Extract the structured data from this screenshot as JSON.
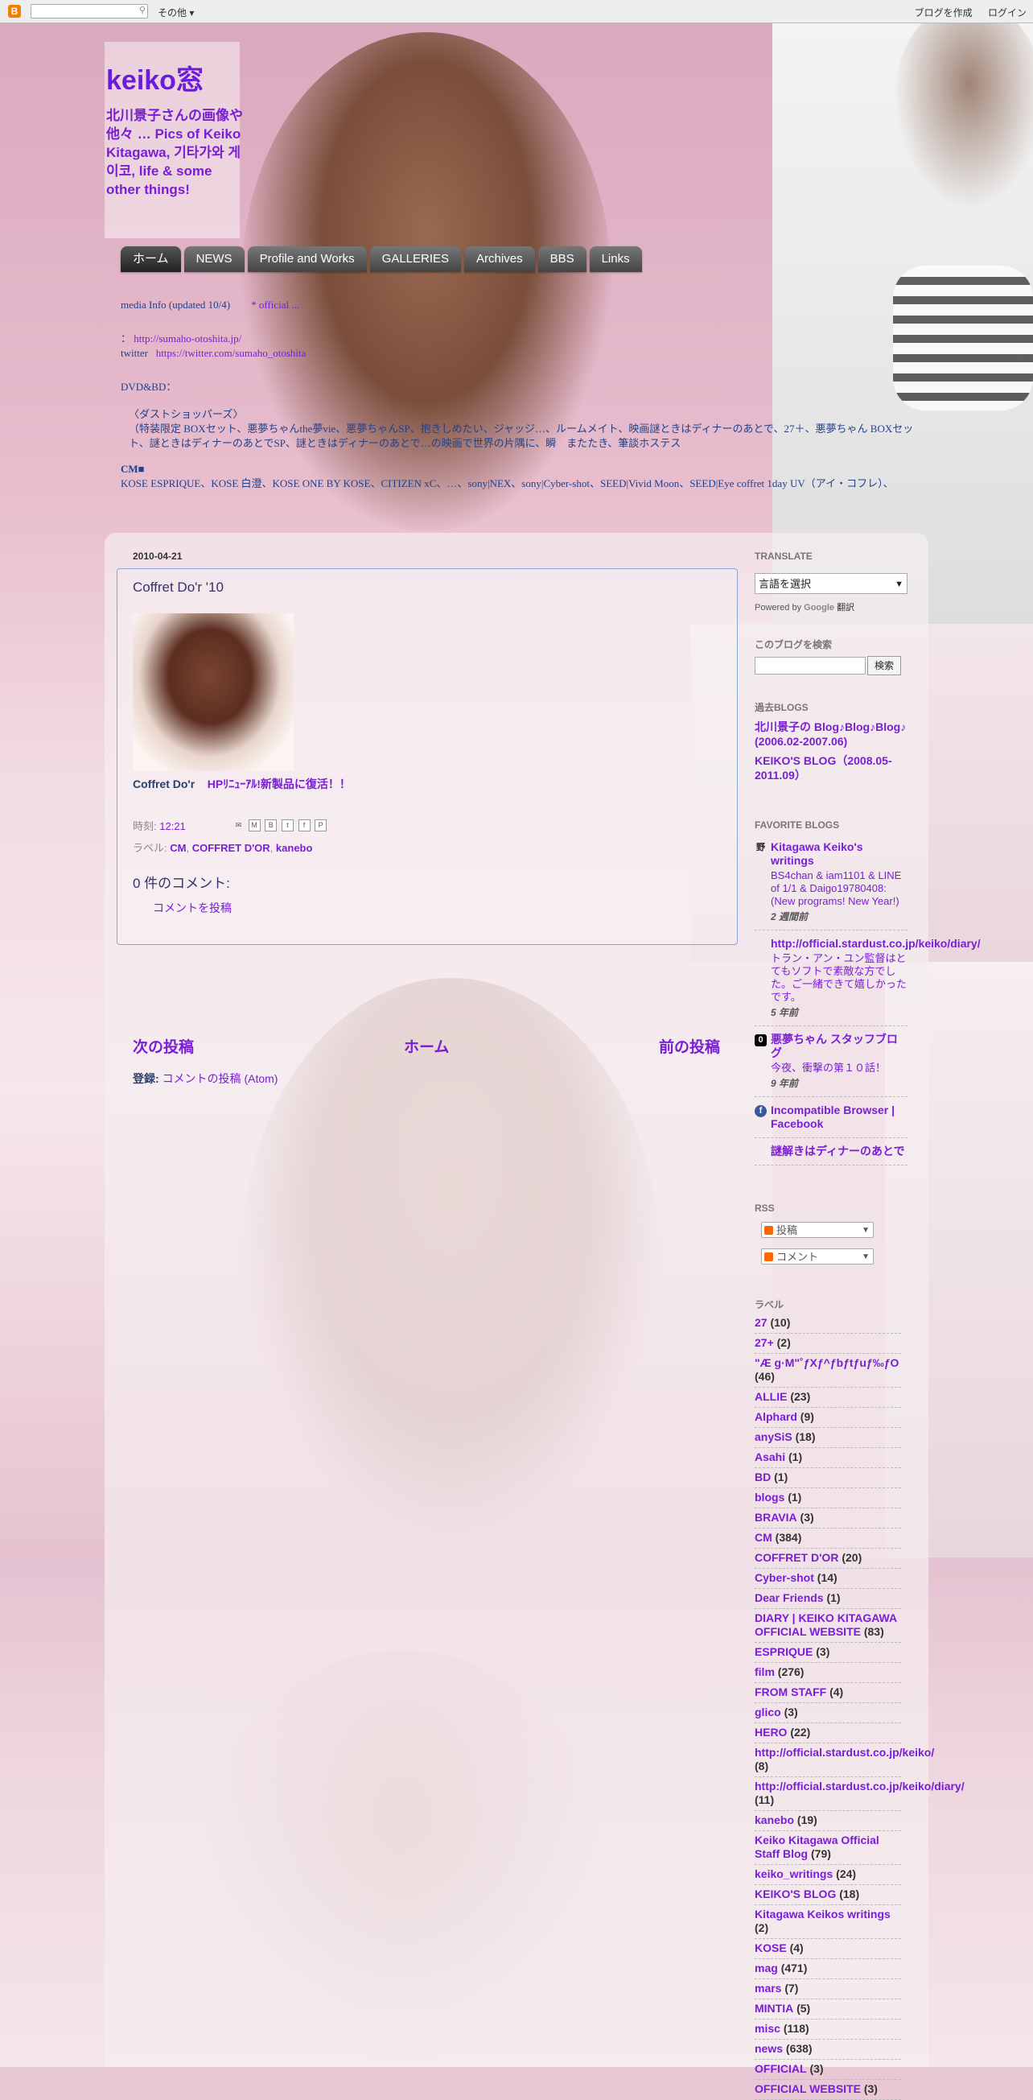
{
  "navbar": {
    "more": "その他 ▾",
    "create_blog": "ブログを作成",
    "login": "ログイン"
  },
  "header": {
    "title": "keiko窓",
    "description": "北川景子さんの画像や他々 … Pics of Keiko Kitagawa, 기타가와 게이코, life & some other things!"
  },
  "tabs": [
    "ホーム",
    "NEWS",
    "Profile and Works",
    "GALLERIES",
    "Archives",
    "BBS",
    "Links"
  ],
  "info": {
    "line1_prefix": "media Info (updated 10/4)",
    "line1_link": "* official ...",
    "line2_label": "：",
    "line2_link": "http://sumaho-otoshita.jp/",
    "line3_label": "twitter",
    "line3_link": "https://twitter.com/sumaho_otoshita",
    "dvd_label": "DVD&BD：",
    "dvd_l1": "〈ダストショッパーズ〉",
    "dvd_l2": "（特装限定 BOXセット、悪夢ちゃんthe夢vie、悪夢ちゃんSP、抱きしめたい、ジャッジ…、ルームメイト、映画謎ときはディナーのあとで、27＋、悪夢ちゃん BOXセット、謎ときはディナーのあとでSP、謎ときはディナーのあとで…の映画で世界の片隅に、瞬　またたき、筆談ホステス",
    "cm_label": "CM■",
    "cm_text": "KOSE ESPRIQUE、KOSE 白澄、KOSE ONE BY KOSE、CITIZEN xC、…、sony|NEX、sony|Cyber-shot、SEED|Vivid Moon、SEED|Eye coffret 1day UV（アイ・コフレ）、"
  },
  "post": {
    "date": "2010-04-21",
    "title": "Coffret Do'r '10",
    "body_prefix": "Coffret Do'r",
    "body_link": "HPﾘﾆｭｰｱﾙ!新製品に復活！！",
    "time_label": "時刻:",
    "time": "12:21",
    "labels_label": "ラベル:",
    "labels": [
      "CM",
      "COFFRET D'OR",
      "kanebo"
    ],
    "comment_count": "0 件のコメント:",
    "post_comment": "コメントを投稿"
  },
  "pager": {
    "newer": "次の投稿",
    "home": "ホーム",
    "older": "前の投稿",
    "subscribe_label": "登録:",
    "subscribe_link": "コメントの投稿 (Atom)"
  },
  "sidebar": {
    "translate_heading": "TRANSLATE",
    "translate_select": "言語を選択",
    "powered_by": "Powered by",
    "google": "Google",
    "translate": "翻訳",
    "search_heading": "このブログを検索",
    "search_button": "検索",
    "past_heading": "過去BLOGS",
    "past": [
      "北川景子の Blog♪Blog♪Blog♪ (2006.02-2007.06)",
      "KEIKO'S BLOG（2008.05-2011.09）"
    ],
    "fav_heading": "FAVORITE BLOGS",
    "favorites": [
      {
        "icon": "野",
        "title": "Kitagawa Keiko's writings",
        "desc": "BS4chan & iam1101 & LINE of 1/1 & Daigo19780408: (New programs! New Year!)",
        "ago": "2 週間前"
      },
      {
        "icon": "",
        "title": "http://official.stardust.co.jp/keiko/diary/",
        "desc": "トラン・アン・ユン監督はとてもソフトで素敵な方でした。ご一緒できて嬉しかったです。",
        "ago": "5 年前"
      },
      {
        "icon": "0",
        "title": "悪夢ちゃん スタッフブログ",
        "desc": "今夜、衝撃の第１０話！",
        "ago": "9 年前"
      },
      {
        "icon": "f",
        "title": "Incompatible Browser | Facebook",
        "desc": "",
        "ago": ""
      },
      {
        "icon": "",
        "title": "謎解きはディナーのあとで",
        "desc": "",
        "ago": ""
      }
    ],
    "rss_heading": "RSS",
    "rss_posts": "投稿",
    "rss_comments": "コメント",
    "labels_heading": "ラベル",
    "labels": [
      {
        "name": "27",
        "count": "(10)"
      },
      {
        "name": "27+",
        "count": "(2)"
      },
      {
        "name": "\"Æ g·M\"˚ƒXƒ^ƒbƒtƒuƒ‰ƒO",
        "count": "(46)"
      },
      {
        "name": "ALLIE",
        "count": "(23)"
      },
      {
        "name": "Alphard",
        "count": "(9)"
      },
      {
        "name": "anySiS",
        "count": "(18)"
      },
      {
        "name": "Asahi",
        "count": "(1)"
      },
      {
        "name": "BD",
        "count": "(1)"
      },
      {
        "name": "blogs",
        "count": "(1)"
      },
      {
        "name": "BRAVIA",
        "count": "(3)"
      },
      {
        "name": "CM",
        "count": "(384)"
      },
      {
        "name": "COFFRET D'OR",
        "count": "(20)"
      },
      {
        "name": "Cyber-shot",
        "count": "(14)"
      },
      {
        "name": "Dear Friends",
        "count": "(1)"
      },
      {
        "name": "DIARY | KEIKO KITAGAWA OFFICIAL WEBSITE",
        "count": "(83)"
      },
      {
        "name": "ESPRIQUE",
        "count": "(3)"
      },
      {
        "name": "film",
        "count": "(276)"
      },
      {
        "name": "FROM STAFF",
        "count": "(4)"
      },
      {
        "name": "glico",
        "count": "(3)"
      },
      {
        "name": "HERO",
        "count": "(22)"
      },
      {
        "name": "http://official.stardust.co.jp/keiko/",
        "count": "(8)"
      },
      {
        "name": "http://official.stardust.co.jp/keiko/diary/",
        "count": "(11)"
      },
      {
        "name": "kanebo",
        "count": "(19)"
      },
      {
        "name": "Keiko Kitagawa Official Staff Blog",
        "count": "(79)"
      },
      {
        "name": "keiko_writings",
        "count": "(24)"
      },
      {
        "name": "KEIKO'S BLOG",
        "count": "(18)"
      },
      {
        "name": "Kitagawa Keikos writings",
        "count": "(2)"
      },
      {
        "name": "KOSE",
        "count": "(4)"
      },
      {
        "name": "mag",
        "count": "(471)"
      },
      {
        "name": "mars",
        "count": "(7)"
      },
      {
        "name": "MINTIA",
        "count": "(5)"
      },
      {
        "name": "misc",
        "count": "(118)"
      },
      {
        "name": "news",
        "count": "(638)"
      },
      {
        "name": "OFFICIAL",
        "count": "(3)"
      },
      {
        "name": "OFFICIAL WEBSITE",
        "count": "(3)"
      }
    ]
  }
}
